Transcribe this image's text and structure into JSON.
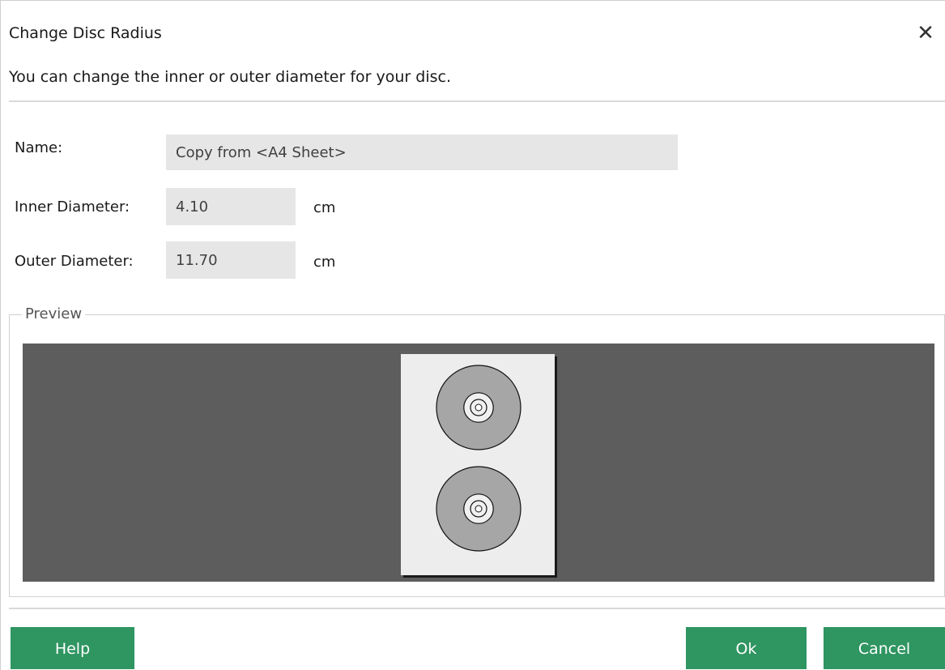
{
  "dialog": {
    "title": "Change Disc Radius",
    "close_glyph": "✕",
    "subtitle": "You can change the inner or outer diameter for your disc."
  },
  "form": {
    "name_label": "Name:",
    "name_value": "Copy from <A4 Sheet>",
    "inner_label": "Inner Diameter:",
    "inner_value": "4.10",
    "inner_unit": "cm",
    "outer_label": "Outer Diameter:",
    "outer_value": "11.70",
    "outer_unit": "cm"
  },
  "preview": {
    "legend": "Preview",
    "background_color": "#5d5d5d",
    "sheet_color": "#ededed",
    "disc_color": "#a6a6a6",
    "disc_count": 2
  },
  "buttons": {
    "help": "Help",
    "ok": "Ok",
    "cancel": "Cancel",
    "color": "#2f9561"
  }
}
